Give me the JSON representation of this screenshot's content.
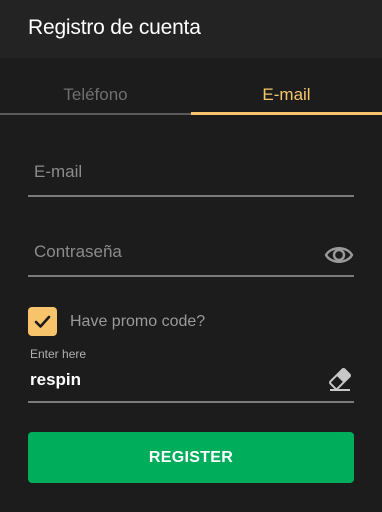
{
  "header": {
    "title": "Registro de cuenta"
  },
  "tabs": [
    {
      "label": "Teléfono",
      "active": false
    },
    {
      "label": "E-mail",
      "active": true
    }
  ],
  "form": {
    "email": {
      "placeholder": "E-mail",
      "value": ""
    },
    "password": {
      "placeholder": "Contraseña",
      "value": "",
      "icon": "eye-icon"
    },
    "promo": {
      "checked": true,
      "label": "Have promo code?",
      "icon": "checkmark-icon"
    },
    "code": {
      "label": "Enter here",
      "value": "respin",
      "icon": "eraser-icon"
    },
    "register_label": "REGISTER"
  },
  "colors": {
    "background": "#1c1c1c",
    "header_bg": "#232323",
    "accent": "#f7c46c",
    "button": "#00ad5a",
    "muted_text": "#8b8b8b"
  }
}
